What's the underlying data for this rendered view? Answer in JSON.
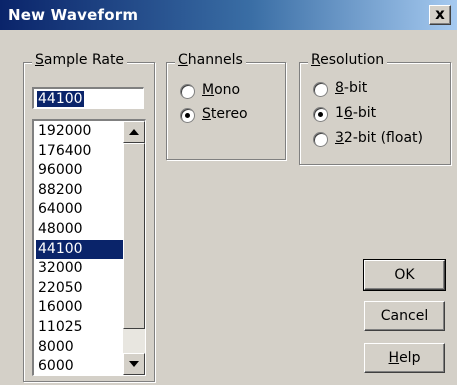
{
  "window": {
    "title": "New Waveform",
    "close_label": "x"
  },
  "sample_rate": {
    "legend": "Sample Rate",
    "legend_mnemonic": "S",
    "legend_rest": "ample Rate",
    "input_value": "44100",
    "items": [
      "192000",
      "176400",
      "96000",
      "88200",
      "64000",
      "48000",
      "44100",
      "32000",
      "22050",
      "16000",
      "11025",
      "8000",
      "6000"
    ],
    "selected": "44100"
  },
  "channels": {
    "legend_mnemonic": "C",
    "legend_rest": "hannels",
    "options": [
      {
        "mn": "M",
        "rest": "ono",
        "checked": false
      },
      {
        "mn": "S",
        "rest": "tereo",
        "checked": true
      }
    ]
  },
  "resolution": {
    "legend_mnemonic": "R",
    "legend_rest": "esolution",
    "options": [
      {
        "mn": "8",
        "rest": "-bit",
        "checked": false
      },
      {
        "pre": "1",
        "mn": "6",
        "rest": "-bit",
        "checked": true
      },
      {
        "mn": "3",
        "rest": "2-bit (float)",
        "checked": false
      }
    ]
  },
  "buttons": {
    "ok": "OK",
    "cancel": "Cancel",
    "help_mnemonic": "H",
    "help_rest": "elp"
  }
}
